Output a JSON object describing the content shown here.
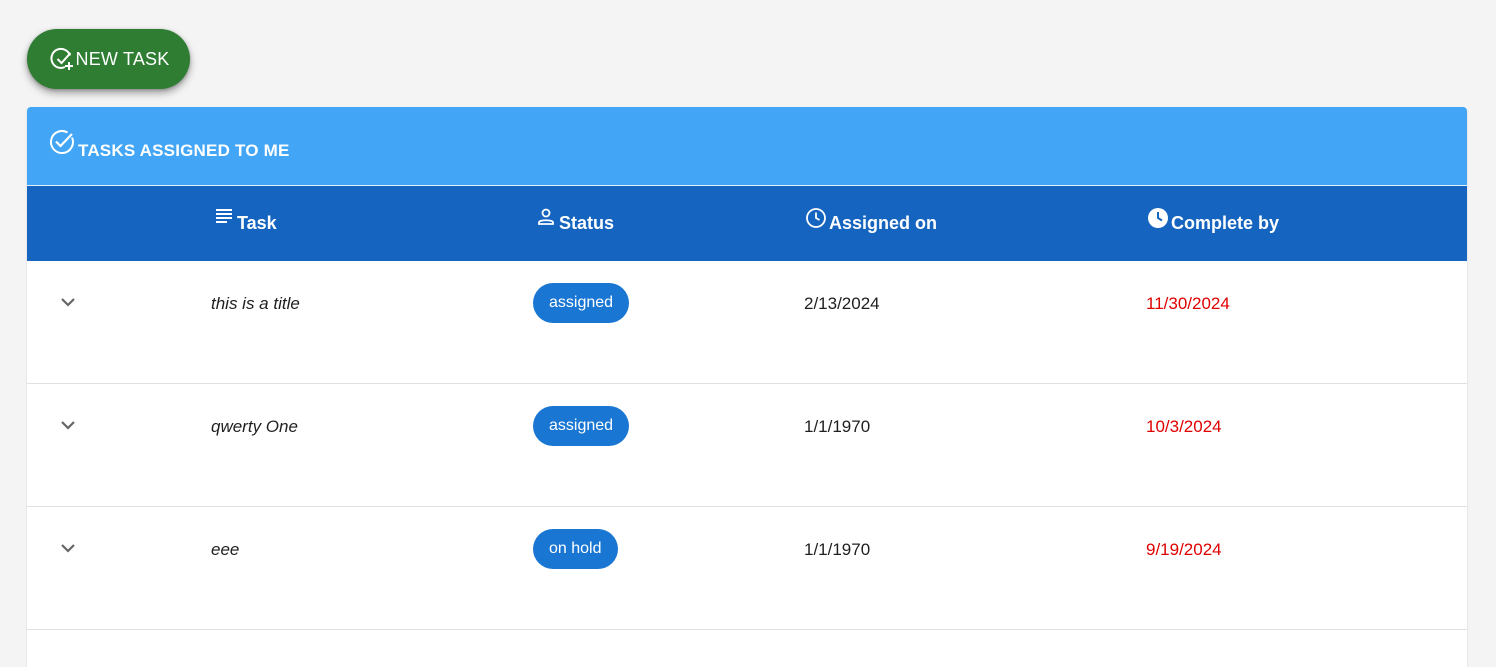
{
  "new_task_button": {
    "label": "NEW TASK",
    "icon": "check-circle-plus-icon",
    "color": "#2e7d32"
  },
  "panel": {
    "title": "TASKS ASSIGNED TO ME",
    "title_icon": "check-circle-icon",
    "header_color": "#42a5f5",
    "table_header_color": "#1565c0"
  },
  "columns": [
    {
      "label": "Task",
      "icon": "text-lines-icon"
    },
    {
      "label": "Status",
      "icon": "person-icon"
    },
    {
      "label": "Assigned on",
      "icon": "clock-outline-icon"
    },
    {
      "label": "Complete by",
      "icon": "clock-filled-icon"
    }
  ],
  "rows": [
    {
      "task": "this is a title",
      "status": "assigned",
      "assigned_on": "2/13/2024",
      "complete_by": "11/30/2024"
    },
    {
      "task": "qwerty One",
      "status": "assigned",
      "assigned_on": "1/1/1970",
      "complete_by": "10/3/2024"
    },
    {
      "task": "eee",
      "status": "on hold",
      "assigned_on": "1/1/1970",
      "complete_by": "9/19/2024"
    }
  ],
  "colors": {
    "badge": "#1976d2",
    "overdue_date": "#e00000"
  }
}
